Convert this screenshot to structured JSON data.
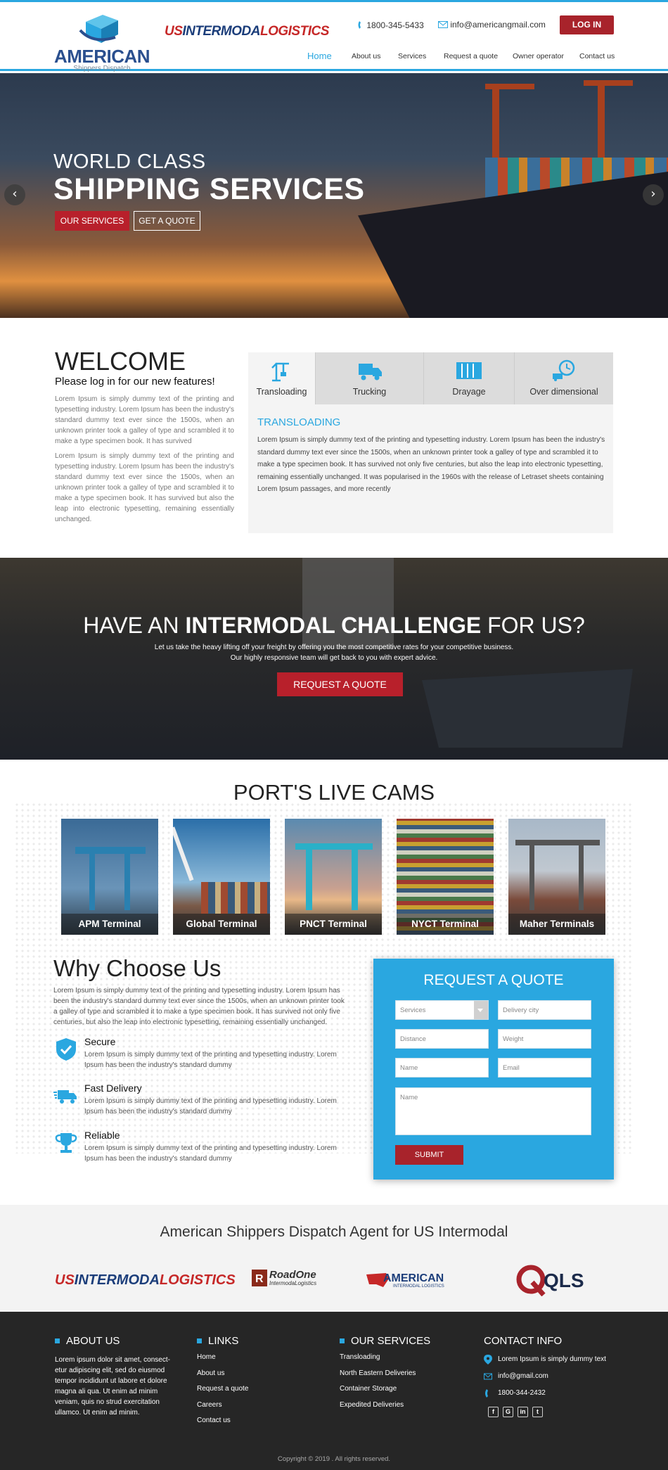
{
  "header": {
    "brand_name": "AMERICAN",
    "brand_sub": "Shippers Dispatch",
    "partner_logo_a": "US",
    "partner_logo_b": "INTERMODA",
    "partner_logo_c": "LOGISTICS",
    "phone": "1800-345-5433",
    "email": "info@americangmail.com",
    "login_label": "LOG IN"
  },
  "nav": [
    "Home",
    "About us",
    "Services",
    "Request a quote",
    "Owner operator",
    "Contact us"
  ],
  "hero": {
    "line1": "WORLD CLASS",
    "line2": "SHIPPING SERVICES",
    "btn_services": "OUR SERVICES",
    "btn_quote": "GET A QUOTE",
    "prev_icon": "chevron-left-icon",
    "next_icon": "chevron-right-icon"
  },
  "welcome": {
    "title": "WELCOME",
    "subtitle": "Please log in for our new features!",
    "para1": "Lorem Ipsum is simply dummy text of the printing and typesetting industry. Lorem Ipsum has been the industry's standard dummy text ever since the 1500s, when an unknown printer took a galley of type and scrambled it to make a type specimen book. It has survived",
    "para2": "Lorem Ipsum is simply dummy text of the printing and typesetting industry. Lorem Ipsum has been the industry's standard dummy text ever since the 1500s, when an unknown printer took a galley of type and scrambled it to make a type specimen book. It has survived but also the leap into electronic typesetting, remaining essentially unchanged."
  },
  "tabs": {
    "items": [
      {
        "label": "Transloading",
        "icon": "crane-icon"
      },
      {
        "label": "Trucking",
        "icon": "truck-icon"
      },
      {
        "label": "Drayage",
        "icon": "container-icon"
      },
      {
        "label": "Over dimensional",
        "icon": "clock-truck-icon"
      }
    ],
    "active_title": "TRANSLOADING",
    "active_text": "Lorem Ipsum is simply dummy text of the printing and typesetting industry. Lorem Ipsum has been the industry's standard dummy text ever since the 1500s, when an unknown printer took a galley of type and scrambled it to make a type specimen book. It has survived not only five centuries, but also the leap into electronic typesetting, remaining essentially unchanged. It was popularised in the 1960s with the release of Letraset sheets containing Lorem Ipsum passages, and more recently"
  },
  "challenge": {
    "title_a": "HAVE AN ",
    "title_b": "INTERMODAL CHALLENGE",
    "title_c": " FOR US?",
    "line1": "Let us take the heavy lifting off your freight by offering you the most competitive rates for your competitive business.",
    "line2": "Our highly responsive team will get back to you with expert advice.",
    "button": "REQUEST A QUOTE"
  },
  "cams": {
    "title": "PORT'S LIVE CAMS",
    "items": [
      "APM Terminal",
      "Global Terminal",
      "PNCT Terminal",
      "NYCT Terminal",
      "Maher Terminals"
    ]
  },
  "why": {
    "title": "Why Choose Us",
    "lead": "Lorem Ipsum is simply dummy text of the printing and typesetting industry. Lorem Ipsum has been the industry's standard dummy text ever since the 1500s, when an unknown printer took a galley of type and scrambled it to make a type specimen book. It has survived not only five centuries, but also the leap into electronic typesetting, remaining essentially unchanged.",
    "features": [
      {
        "title": "Secure",
        "text": "Lorem Ipsum is simply dummy text of the printing and typesetting industry. Lorem Ipsum has been the industry's standard dummy",
        "icon": "shield-check-icon"
      },
      {
        "title": "Fast Delivery",
        "text": "Lorem Ipsum is simply dummy text of the printing and typesetting industry. Lorem Ipsum has been the industry's standard dummy",
        "icon": "fast-truck-icon"
      },
      {
        "title": "Reliable",
        "text": "Lorem Ipsum is simply dummy text of the printing and typesetting industry. Lorem Ipsum has been the industry's standard dummy",
        "icon": "trophy-icon"
      }
    ]
  },
  "quote": {
    "title": "REQUEST A QUOTE",
    "services": "Services",
    "delivery_city": "Delivery city",
    "distance": "Distance",
    "weight": "Weight",
    "name": "Name",
    "email": "Email",
    "message": "Name",
    "submit": "SUBMIT"
  },
  "agent": {
    "title": "American Shippers Dispatch Agent for US Intermodal",
    "roadone": "RoadOne",
    "roadone_sub": "IntermodaLogistics",
    "american": "AMERICAN",
    "american_sub": "INTERMODAL LOGISTICS",
    "qls": "QLS"
  },
  "footer": {
    "about_title": "ABOUT US",
    "about_text": "Lorem ipsum dolor sit amet, consect-etur adipiscing elit, sed do eiusmod tempor incididunt ut labore et dolore magna ali qua. Ut enim ad minim veniam, quis no strud exercitation ullamco. Ut enim ad minim.",
    "links_title": "LINKS",
    "links": [
      "Home",
      "About us",
      "Request a quote",
      "Careers",
      "Contact us"
    ],
    "services_title": "OUR SERVICES",
    "services": [
      "Transloading",
      "North Eastern Deliveries",
      "Container Storage",
      "Expedited Deliveries"
    ],
    "contact_title": "CONTACT INFO",
    "address": "Lorem Ipsum is simply dummy text",
    "email": "info@gmail.com",
    "phone": "1800-344-2432",
    "social": [
      "f",
      "G",
      "in",
      "t"
    ],
    "copyright": "Copyright © 2019 . All rights reserved."
  },
  "colors": {
    "accent": "#2aa7e0",
    "brand_red": "#b8202b",
    "footer_bg": "#262626"
  }
}
